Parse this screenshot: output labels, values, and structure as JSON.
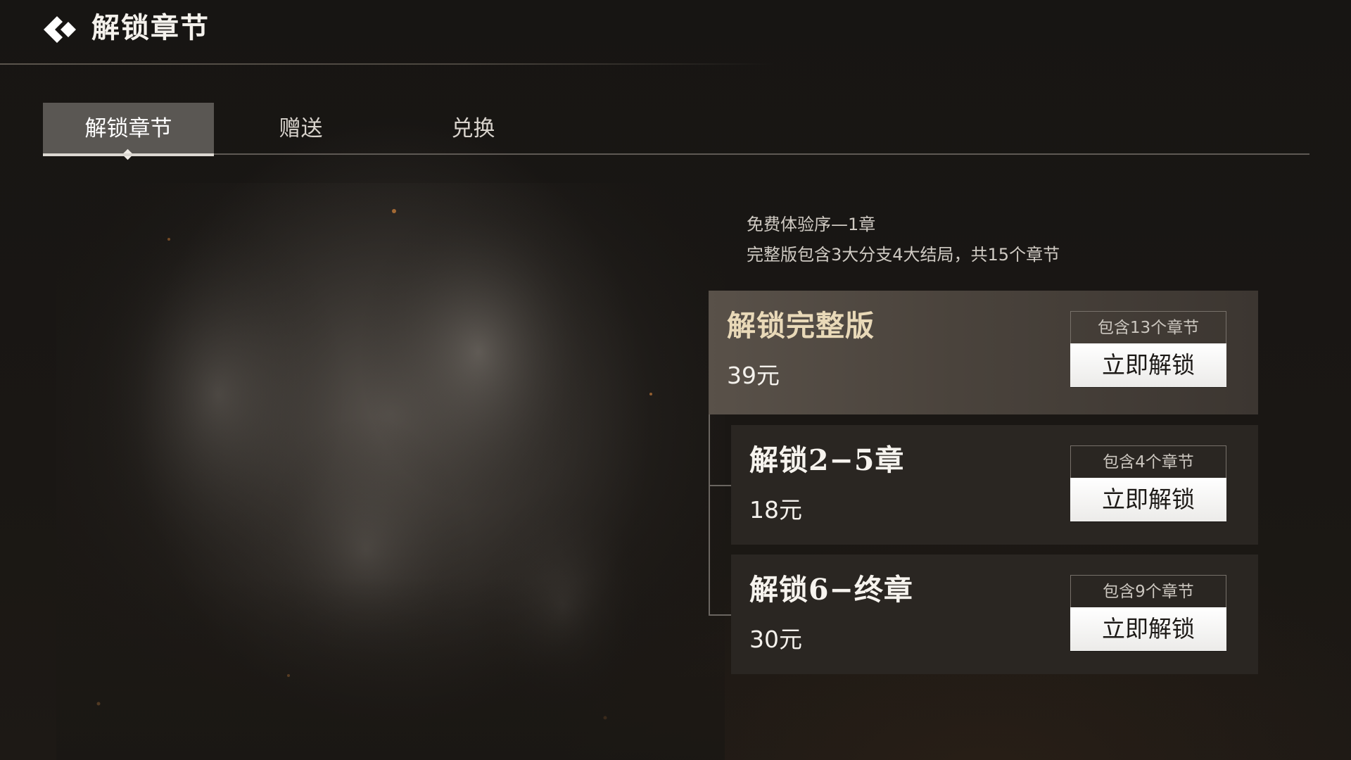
{
  "header": {
    "title": "解锁章节",
    "back_icon": "back-chevron-icon"
  },
  "tabs": [
    {
      "label": "解锁章节",
      "active": true
    },
    {
      "label": "赠送",
      "active": false
    },
    {
      "label": "兑换",
      "active": false
    }
  ],
  "info": {
    "line1": "免费体验序—1章",
    "line2": "完整版包含3大分支4大结局，共15个章节"
  },
  "offers": [
    {
      "title": "解锁完整版",
      "price": "39元",
      "chapters": "包含13个章节",
      "button": "立即解锁",
      "featured": true
    },
    {
      "title": "解锁2−5章",
      "price": "18元",
      "chapters": "包含4个章节",
      "button": "立即解锁",
      "featured": false
    },
    {
      "title": "解锁6−终章",
      "price": "30元",
      "chapters": "包含9个章节",
      "button": "立即解锁",
      "featured": false
    }
  ],
  "colors": {
    "background": "#161412",
    "featured_title": "#e9d9b8",
    "button_bg": "#ffffff"
  }
}
